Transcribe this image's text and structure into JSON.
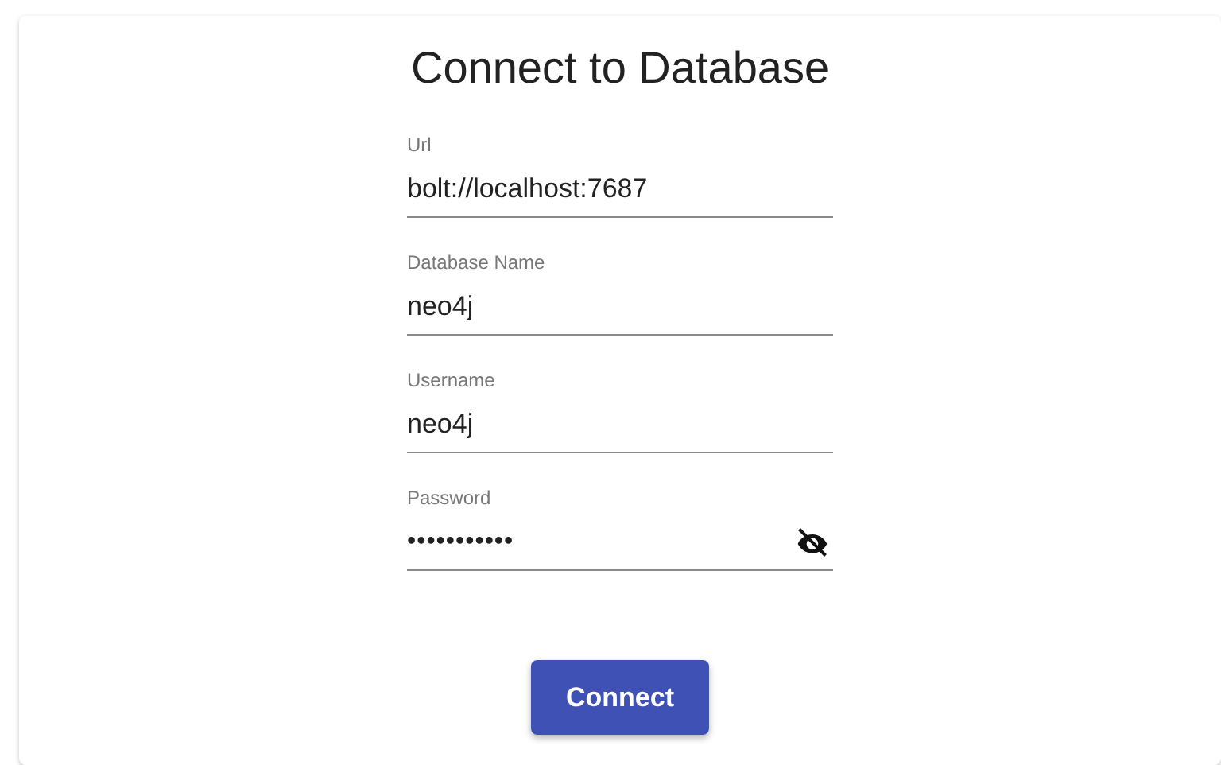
{
  "title": "Connect to Database",
  "fields": [
    {
      "kind": "text",
      "label": "Url",
      "value": "bolt://localhost:7687"
    },
    {
      "kind": "text",
      "label": "Database Name",
      "value": "neo4j"
    },
    {
      "kind": "text",
      "label": "Username",
      "value": "neo4j"
    },
    {
      "kind": "password",
      "label": "Password",
      "value": "•••••••••••"
    }
  ],
  "button": "Connect"
}
